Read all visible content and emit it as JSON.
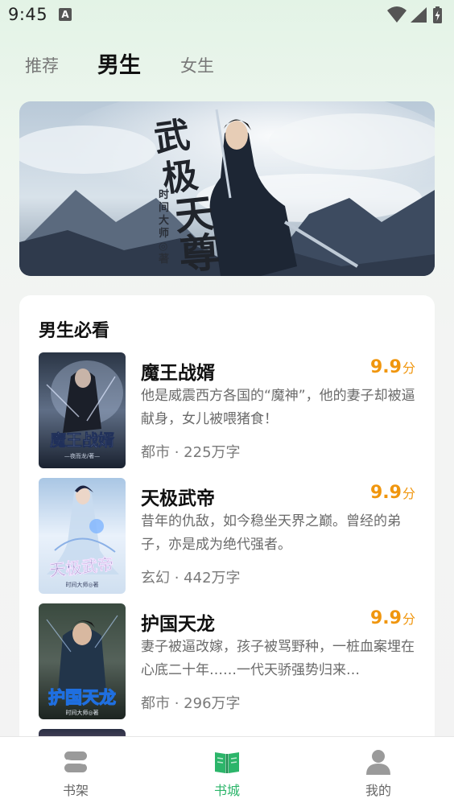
{
  "status_bar": {
    "time": "9:45",
    "notification_icon": "A",
    "icons": [
      "wifi-icon",
      "signal-icon",
      "battery-charging-icon"
    ]
  },
  "tabs": [
    {
      "label": "推荐",
      "active": false
    },
    {
      "label": "男生",
      "active": true
    },
    {
      "label": "女生",
      "active": false
    }
  ],
  "banner": {
    "title_art": "武极天尊",
    "author_art": "时间大师◎著"
  },
  "section": {
    "title": "男生必看",
    "books": [
      {
        "title": "魔王战婿",
        "score": "9.9",
        "score_unit": "分",
        "desc": "他是威震西方各国的“魔神”，他的妻子却被逼献身，女儿被喂猪食！",
        "meta": "都市 · 225万字",
        "cover_title": "魔王战婿",
        "cover_author": "—夜而龙/著—"
      },
      {
        "title": "天极武帝",
        "score": "9.9",
        "score_unit": "分",
        "desc": "昔年的仇敌，如今稳坐天界之巅。曾经的弟子，亦是成为绝代强者。",
        "meta": "玄幻 · 442万字",
        "cover_title": "天极武帝",
        "cover_author": "时间大师◎著"
      },
      {
        "title": "护国天龙",
        "score": "9.9",
        "score_unit": "分",
        "desc": "妻子被逼改嫁，孩子被骂野种，一桩血案埋在心底二十年……一代天骄强势归来…",
        "meta": "都市 · 296万字",
        "cover_title": "护国天龙",
        "cover_author": "时间大师◎著"
      }
    ]
  },
  "bottom_nav": [
    {
      "label": "书架",
      "icon": "bookshelf-icon",
      "active": false
    },
    {
      "label": "书城",
      "icon": "book-open-icon",
      "active": true
    },
    {
      "label": "我的",
      "icon": "user-icon",
      "active": false
    }
  ],
  "colors": {
    "accent": "#2cb56a",
    "score": "#f0960e"
  }
}
